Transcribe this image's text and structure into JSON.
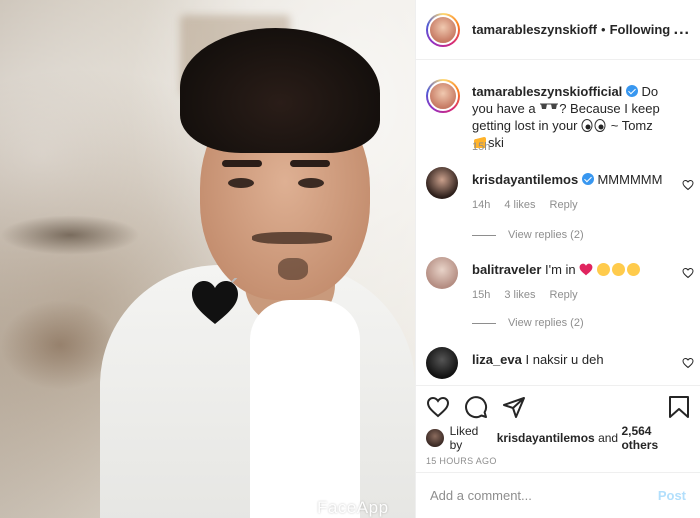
{
  "post": {
    "watermark": "FaceApp"
  },
  "header": {
    "username": "tamarableszynskiofficial",
    "dot": "•",
    "follow_status": "Following",
    "more": "..."
  },
  "caption": {
    "username": "tamarableszynskiofficial",
    "text_part1": "Do you have a ",
    "text_part2": "? Because I keep getting lost in your ",
    "text_part3": " ~ Tomz ",
    "text_part4": "ski",
    "time": "15h"
  },
  "comments": [
    {
      "username": "krisdayantilemos",
      "verified": true,
      "text": "MMMMMM",
      "time": "14h",
      "likes": "4 likes",
      "reply": "Reply",
      "view_replies": "View replies (2)"
    },
    {
      "username": "balitraveler",
      "verified": false,
      "text": "I'm in ",
      "time": "15h",
      "likes": "3 likes",
      "reply": "Reply",
      "view_replies": "View replies (2)"
    },
    {
      "username": "liza_eva",
      "verified": false,
      "text": "I naksir u deh"
    }
  ],
  "actions": {
    "liked_by_prefix": "Liked by ",
    "liked_by_user": "krisdayantilemos",
    "liked_by_middle": " and ",
    "liked_by_count": "2,564 others",
    "timestamp": "15 HOURS AGO"
  },
  "add_comment": {
    "placeholder": "Add a comment...",
    "post_label": "Post"
  },
  "colors": {
    "link_blue": "#3897f0",
    "post_disabled": "#b2dffc",
    "heart_red": "#ed4956"
  }
}
